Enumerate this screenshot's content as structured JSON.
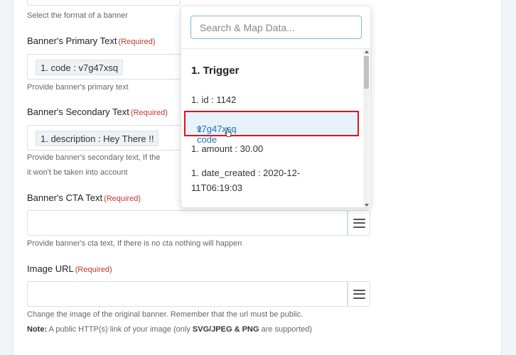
{
  "form": {
    "format_hint": "Select the format of a banner",
    "primary": {
      "label": "Banner's Primary Text",
      "required": "(Required)",
      "token": "1. code : v7g47xsq",
      "hint": "Provide banner's primary text"
    },
    "secondary": {
      "label": "Banner's Secondary Text",
      "required": "(Required)",
      "token": "1. description : Hey There !!",
      "hint_line1": "Provide banner's secondary text, If the",
      "hint_line2": "it won't be taken into account"
    },
    "cta": {
      "label": "Banner's CTA Text",
      "required": "(Required)",
      "value": "",
      "hint": "Provide banner's cta text, If there is no cta nothing will happen"
    },
    "image": {
      "label": "Image URL",
      "required": "(Required)",
      "value": "",
      "hint": "Change the image of the original banner. Remember that the url must be public.",
      "note_label": "Note:",
      "note_text_1": " A public HTTP(s) link of your image (only ",
      "note_bold": "SVG/JPEG & PNG",
      "note_text_2": " are supported)"
    }
  },
  "dropdown": {
    "search_placeholder": "Search & Map Data...",
    "section": "1. Trigger",
    "items": [
      "1. id : 1142",
      "1. code : v7g47xsq",
      "1. amount : 30.00",
      "1. date_created : 2020-12-",
      "11T06:19:03"
    ],
    "highlight_prefix": "1. code",
    "highlight_suffix": " v7g47xsq"
  },
  "icons": {
    "menu": "hamburger-menu-icon",
    "cursor": "hand-pointer-icon"
  },
  "colors": {
    "required": "#c0392b",
    "highlight_border": "#e0141b",
    "highlight_text": "#1e73be"
  }
}
